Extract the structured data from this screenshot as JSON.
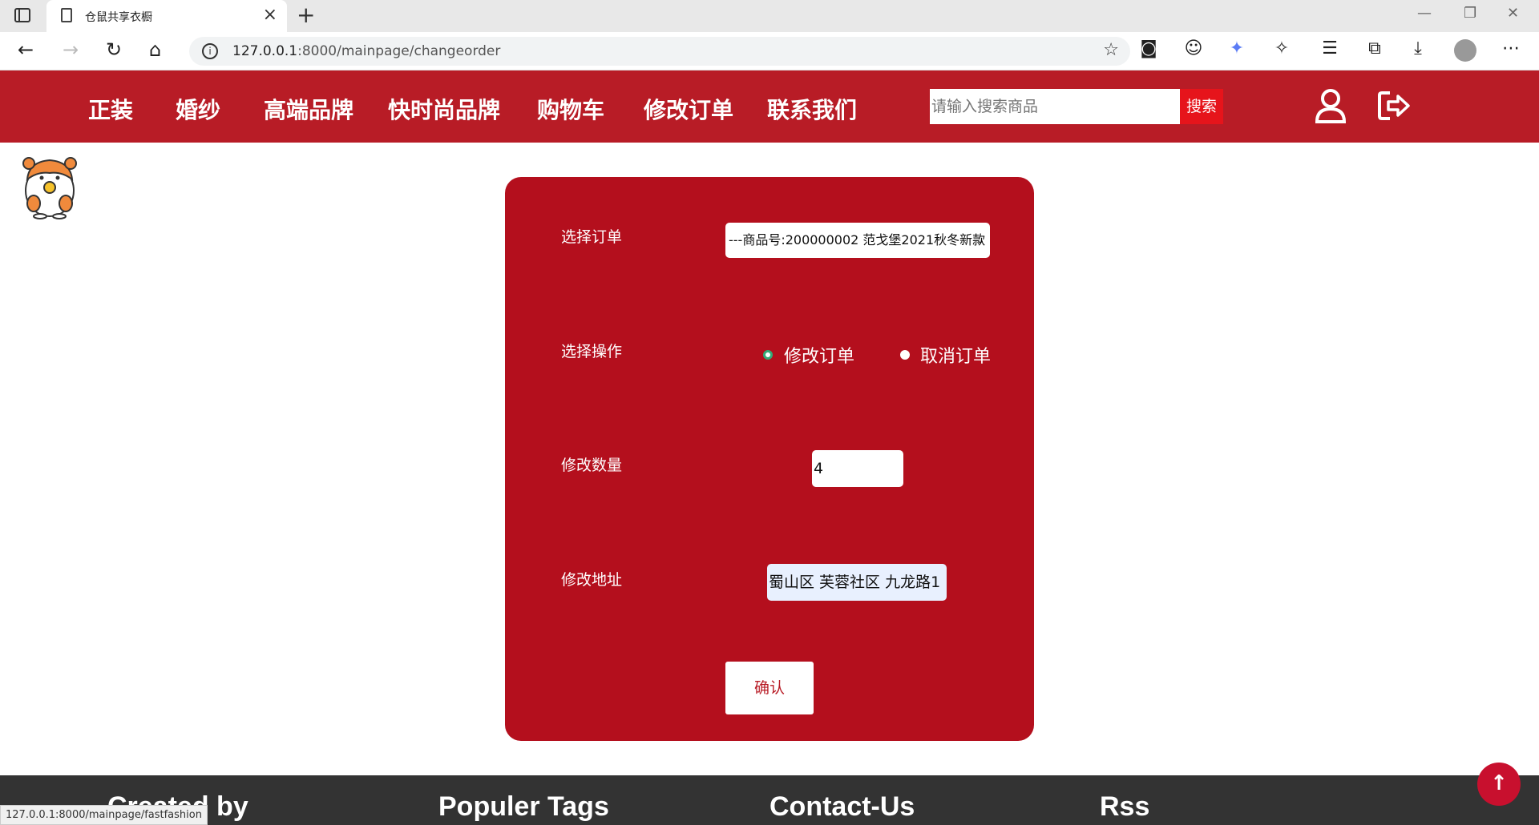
{
  "browser": {
    "tab_title": "仓鼠共享衣橱",
    "url_host": "127.0.0.1",
    "url_path": ":8000/mainpage/changeorder",
    "status_url": "127.0.0.1:8000/mainpage/fastfashion"
  },
  "nav": {
    "items": [
      "正装",
      "婚纱",
      "高端品牌",
      "快时尚品牌",
      "购物车",
      "修改订单",
      "联系我们"
    ],
    "search_placeholder": "请输入搜索商品",
    "search_button": "搜索"
  },
  "form": {
    "order_label": "选择订单",
    "order_selected": "---商品号:200000002 范戈堡2021秋冬新款",
    "operation_label": "选择操作",
    "operations": [
      {
        "label": "修改订单",
        "checked": true
      },
      {
        "label": "取消订单",
        "checked": false
      }
    ],
    "quantity_label": "修改数量",
    "quantity_value": "4",
    "address_label": "修改地址",
    "address_value": "蜀山区 芙蓉社区 九龙路1",
    "confirm_button": "确认"
  },
  "footer": {
    "headings": [
      "Created by",
      "Populer Tags",
      "Contact-Us",
      "Rss"
    ]
  },
  "colors": {
    "header_bg": "#b81c26",
    "card_bg": "#b40f1d",
    "search_btn": "#e6141b",
    "footer_bg": "#333333"
  }
}
